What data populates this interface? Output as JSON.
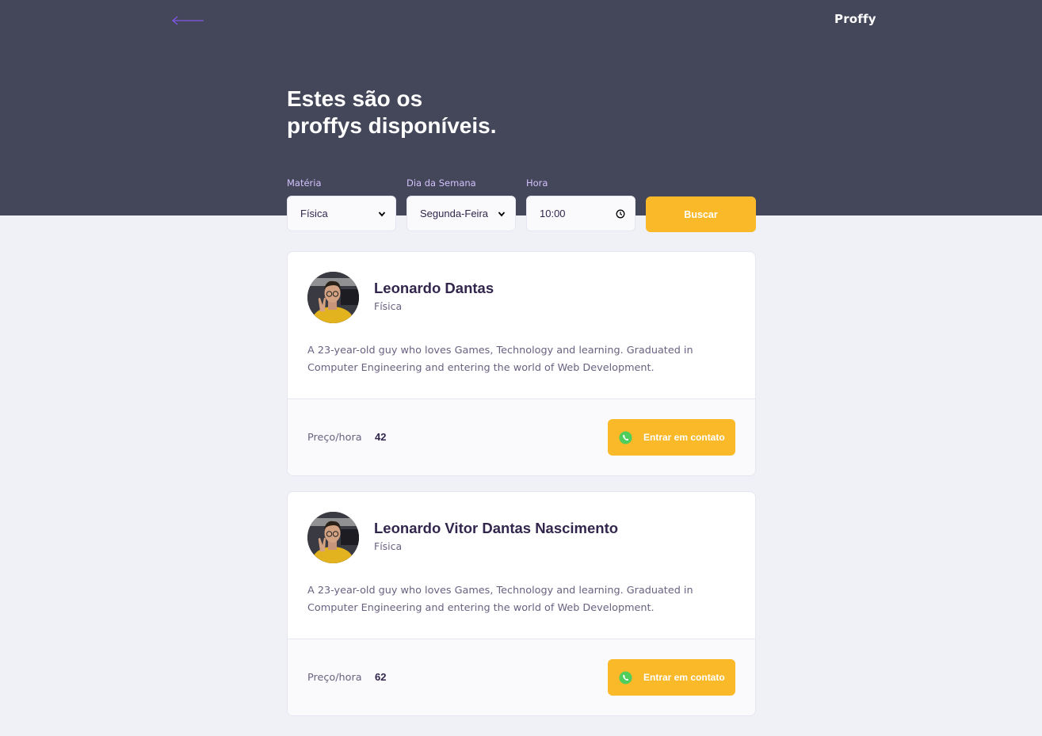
{
  "header": {
    "logo": "Proffy",
    "title_line1": "Estes são os",
    "title_line2": "proffys disponíveis."
  },
  "filters": {
    "subject": {
      "label": "Matéria",
      "value": "Física"
    },
    "weekday": {
      "label": "Dia da Semana",
      "value": "Segunda-Feira"
    },
    "time": {
      "label": "Hora",
      "value": "10:00"
    },
    "search_label": "Buscar"
  },
  "teachers": [
    {
      "name": "Leonardo Dantas",
      "subject": "Física",
      "bio_line1": "A 23-year-old guy who loves Games, Technology and learning. Graduated in",
      "bio_line2": "Computer Engineering and entering the world of Web Development.",
      "price_label": "Preço/hora",
      "price": "42",
      "contact_label": "Entrar em contato"
    },
    {
      "name": "Leonardo Vitor Dantas Nascimento",
      "subject": "Física",
      "bio_line1": "A 23-year-old guy who loves Games, Technology and learning. Graduated in",
      "bio_line2": "Computer Engineering and entering the world of Web Development.",
      "price_label": "Preço/hora",
      "price": "62",
      "contact_label": "Entrar em contato"
    }
  ],
  "colors": {
    "header_bg": "#434759",
    "page_bg": "#F0F0F7",
    "accent": "#FAB928",
    "label": "#D4C2FF",
    "whatsapp": "#4FCE5D"
  }
}
